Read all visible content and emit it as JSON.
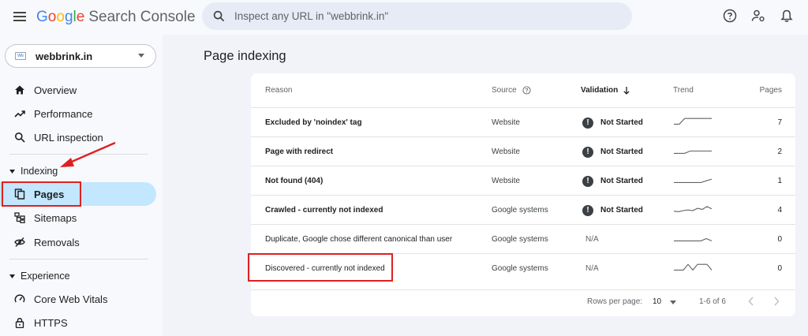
{
  "header": {
    "logo_google": "Google",
    "logo_product": "Search Console",
    "search_placeholder": "Inspect any URL in \"webbrink.in\"",
    "icons": [
      "menu-icon",
      "search-icon",
      "help-icon",
      "account-settings-icon",
      "notifications-icon"
    ]
  },
  "sidebar": {
    "property": {
      "name": "webbrink.in",
      "favicon_text": "Wb"
    },
    "items": [
      {
        "label": "Overview",
        "icon": "home-icon"
      },
      {
        "label": "Performance",
        "icon": "trending-up-icon"
      },
      {
        "label": "URL inspection",
        "icon": "search-icon"
      }
    ],
    "indexing_section": "Indexing",
    "indexing_items": [
      {
        "label": "Pages",
        "icon": "pages-icon",
        "active": true
      },
      {
        "label": "Sitemaps",
        "icon": "sitemap-icon"
      },
      {
        "label": "Removals",
        "icon": "removals-icon"
      }
    ],
    "experience_section": "Experience",
    "experience_items": [
      {
        "label": "Core Web Vitals",
        "icon": "gauge-icon"
      },
      {
        "label": "HTTPS",
        "icon": "lock-icon"
      }
    ]
  },
  "main": {
    "title": "Page indexing",
    "table": {
      "headers": {
        "reason": "Reason",
        "source": "Source",
        "validation": "Validation",
        "trend": "Trend",
        "pages": "Pages"
      },
      "rows": [
        {
          "reason": "Excluded by 'noindex' tag",
          "source": "Website",
          "validation": "Not Started",
          "status": "started",
          "pages": "7",
          "trend": [
            0,
            0,
            1,
            1,
            1,
            1,
            1,
            1
          ]
        },
        {
          "reason": "Page with redirect",
          "source": "Website",
          "validation": "Not Started",
          "status": "started",
          "pages": "2",
          "trend": [
            0,
            0,
            0,
            0.4,
            0.4,
            0.4,
            0.4,
            0.4
          ]
        },
        {
          "reason": "Not found (404)",
          "source": "Website",
          "validation": "Not Started",
          "status": "started",
          "pages": "1",
          "trend": [
            0,
            0,
            0,
            0,
            0,
            0,
            0.3,
            0.6
          ]
        },
        {
          "reason": "Crawled - currently not indexed",
          "source": "Google systems",
          "validation": "Not Started",
          "status": "started",
          "pages": "4",
          "trend": [
            0.1,
            0,
            0.2,
            0.3,
            0.2,
            0.6,
            0.4,
            0.9,
            0.5
          ]
        },
        {
          "reason": "Duplicate, Google chose different canonical than user",
          "source": "Google systems",
          "validation": "N/A",
          "status": "na",
          "pages": "0",
          "trend": [
            0,
            0,
            0,
            0,
            0,
            0,
            0.4,
            0
          ]
        },
        {
          "reason": "Discovered - currently not indexed",
          "source": "Google systems",
          "validation": "N/A",
          "status": "na",
          "pages": "0",
          "trend": [
            0,
            0,
            0,
            1,
            0,
            1,
            1,
            1,
            0
          ]
        }
      ],
      "footer": {
        "rows_per_page_label": "Rows per page:",
        "rows_per_page": "10",
        "range": "1-6 of 6"
      }
    }
  },
  "colors": {
    "active_nav": "#c2e7ff",
    "annotation_red": "#e02020",
    "card": "#ffffff",
    "background": "#f1f3f8"
  }
}
